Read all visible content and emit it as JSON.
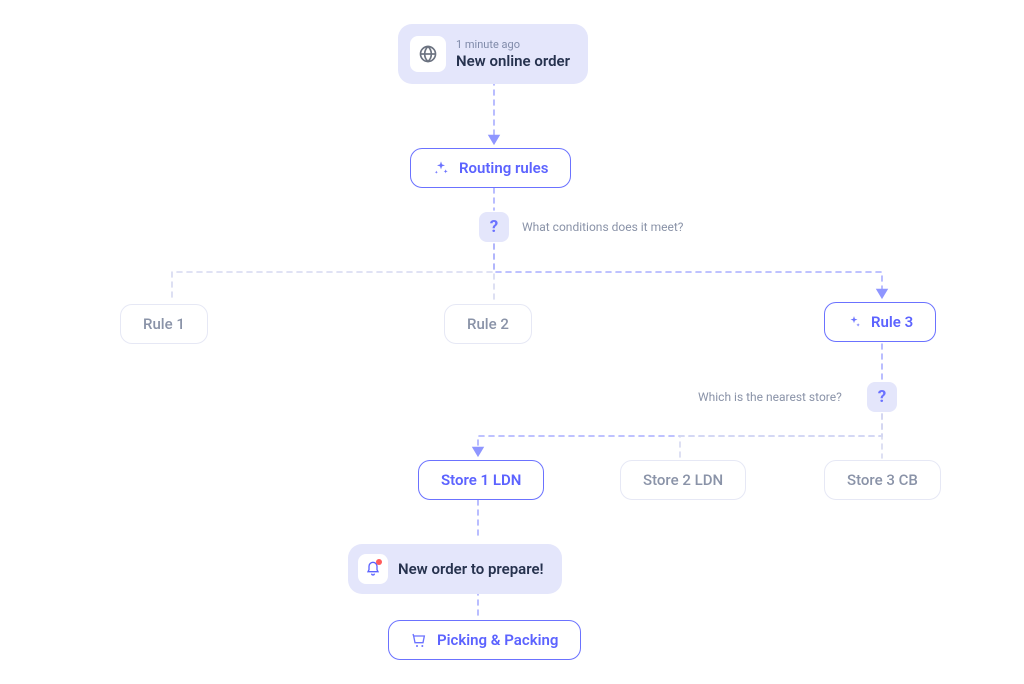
{
  "event": {
    "time": "1 minute ago",
    "title": "New online order"
  },
  "routing": {
    "label": "Routing rules"
  },
  "decisions": {
    "conditions": {
      "question": "?",
      "label": "What conditions does it meet?"
    },
    "nearest": {
      "question": "?",
      "label": "Which is the nearest store?"
    }
  },
  "rules": {
    "r1": "Rule 1",
    "r2": "Rule 2",
    "r3": "Rule 3"
  },
  "stores": {
    "s1": "Store 1 LDN",
    "s2": "Store 2 LDN",
    "s3": "Store 3 CB"
  },
  "notification": {
    "title": "New order to prepare!"
  },
  "picking": {
    "label": "Picking & Packing"
  }
}
